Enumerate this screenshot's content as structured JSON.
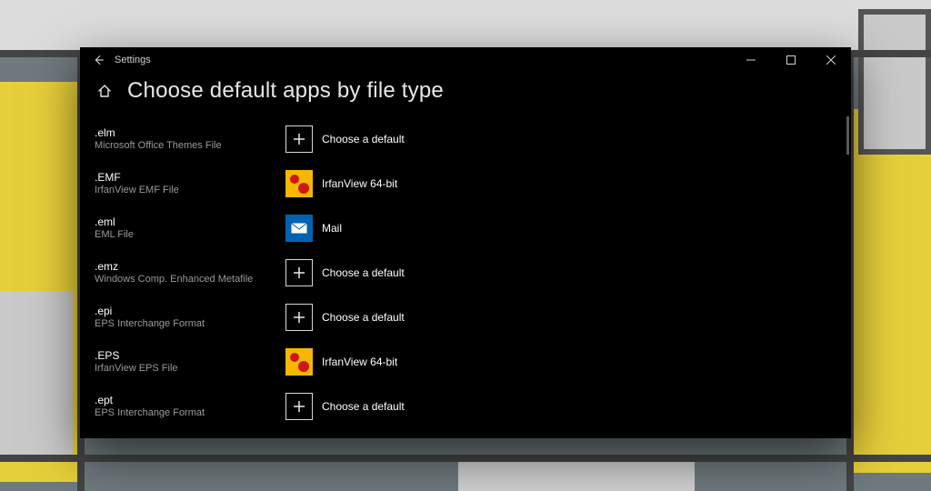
{
  "window": {
    "app_title": "Settings"
  },
  "header": {
    "page_title": "Choose default apps by file type"
  },
  "labels": {
    "choose_default": "Choose a default"
  },
  "apps": {
    "irfanview": "IrfanView 64-bit",
    "mail": "Mail"
  },
  "rows": [
    {
      "ext": ".elm",
      "desc": "Microsoft Office Themes File",
      "app_key": null
    },
    {
      "ext": ".EMF",
      "desc": "IrfanView EMF File",
      "app_key": "irfanview"
    },
    {
      "ext": ".eml",
      "desc": "EML File",
      "app_key": "mail"
    },
    {
      "ext": ".emz",
      "desc": "Windows Comp. Enhanced Metafile",
      "app_key": null
    },
    {
      "ext": ".epi",
      "desc": "EPS Interchange Format",
      "app_key": null
    },
    {
      "ext": ".EPS",
      "desc": "IrfanView EPS File",
      "app_key": "irfanview"
    },
    {
      "ext": ".ept",
      "desc": "EPS Interchange Format",
      "app_key": null
    }
  ]
}
